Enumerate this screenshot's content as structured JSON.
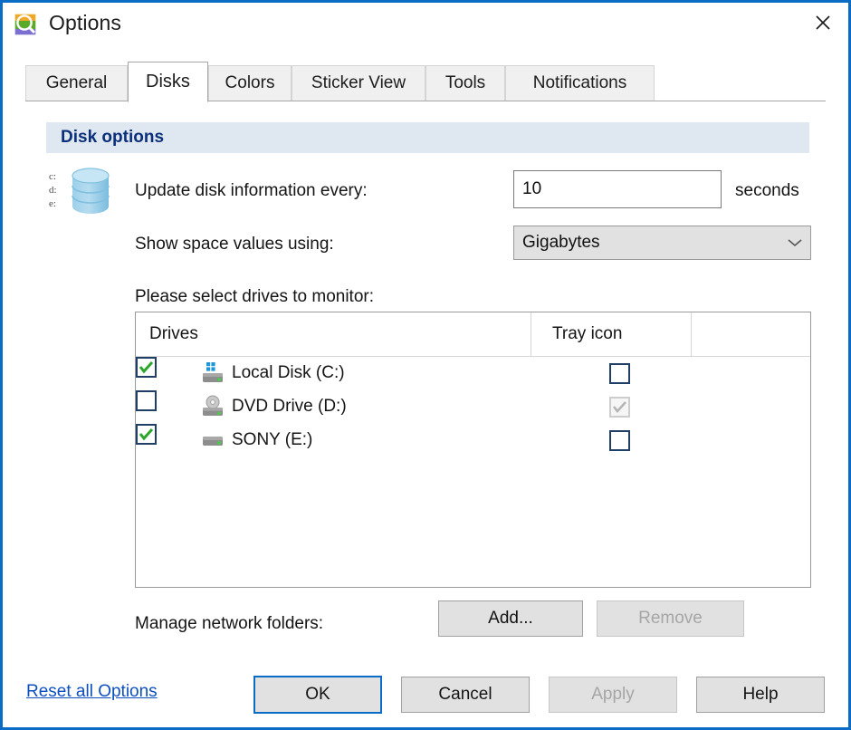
{
  "window": {
    "title": "Options",
    "icon": "app-magnifier-icon",
    "close_label": "close-icon",
    "border_color": "#0a6cc4"
  },
  "tabs": [
    {
      "label": "General",
      "active": false
    },
    {
      "label": "Disks",
      "active": true
    },
    {
      "label": "Colors",
      "active": false
    },
    {
      "label": "Sticker View",
      "active": false
    },
    {
      "label": "Tools",
      "active": false
    },
    {
      "label": "Notifications",
      "active": false
    }
  ],
  "section": {
    "header": "Disk options",
    "header_color": "#0b2f7a",
    "header_bg": "#dfe7f0",
    "disk_icon_letters": "c:\nd:\ne:"
  },
  "form": {
    "update_label": "Update disk information every:",
    "update_value": "10",
    "update_placeholder": "",
    "seconds_label": "seconds",
    "space_label": "Show space values using:",
    "space_value": "Gigabytes",
    "select_drives_label": "Please select drives to monitor:",
    "manage_label": "Manage network folders:"
  },
  "drive_list": {
    "columns": [
      "Drives",
      "Tray icon"
    ],
    "rows": [
      {
        "label": "Local Disk (C:)",
        "icon": "hard-drive-windows-icon",
        "monitor_checked": true,
        "monitor_disabled": false,
        "tray_checked": false,
        "tray_disabled": false
      },
      {
        "label": "DVD Drive (D:)",
        "icon": "dvd-drive-icon",
        "monitor_checked": false,
        "monitor_disabled": false,
        "tray_checked": true,
        "tray_disabled": true
      },
      {
        "label": "SONY (E:)",
        "icon": "removable-drive-icon",
        "monitor_checked": true,
        "monitor_disabled": false,
        "tray_checked": false,
        "tray_disabled": false
      }
    ]
  },
  "network_buttons": {
    "add": "Add...",
    "remove": "Remove",
    "remove_disabled": true
  },
  "footer": {
    "reset_link": "Reset all Options",
    "ok": "OK",
    "cancel": "Cancel",
    "apply": "Apply",
    "help": "Help",
    "apply_disabled": true,
    "ok_is_default": true
  }
}
